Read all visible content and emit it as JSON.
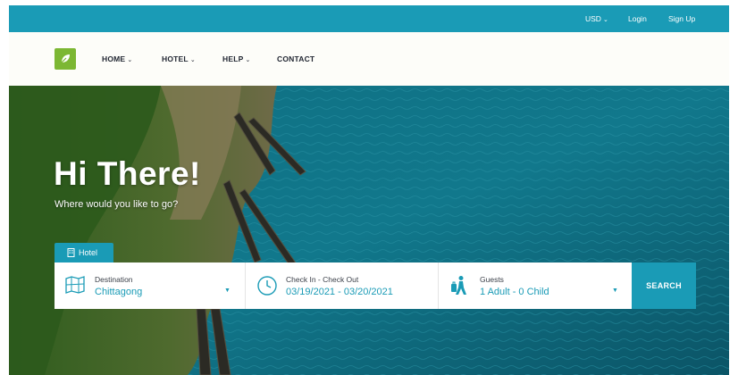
{
  "topbar": {
    "currency": "USD",
    "login": "Login",
    "signup": "Sign Up"
  },
  "nav": {
    "logo_icon": "leaf-logo-icon",
    "items": [
      {
        "label": "HOME",
        "has_dropdown": true
      },
      {
        "label": "HOTEL",
        "has_dropdown": true
      },
      {
        "label": "HELP",
        "has_dropdown": true
      },
      {
        "label": "CONTACT",
        "has_dropdown": false
      }
    ]
  },
  "hero": {
    "title": "Hi There!",
    "subtitle": "Where would you like to go?"
  },
  "search": {
    "tab_label": "Hotel",
    "destination": {
      "label": "Destination",
      "value": "Chittagong",
      "icon": "map-icon"
    },
    "dates": {
      "label": "Check In - Check Out",
      "value": "03/19/2021 - 03/20/2021",
      "icon": "clock-icon"
    },
    "guests": {
      "label": "Guests",
      "value": "1 Adult - 0 Child",
      "icon": "traveler-icon"
    },
    "button": "SEARCH"
  },
  "colors": {
    "primary": "#1a9bb6",
    "logo_green": "#7cb733",
    "nav_text": "#1f2430"
  }
}
